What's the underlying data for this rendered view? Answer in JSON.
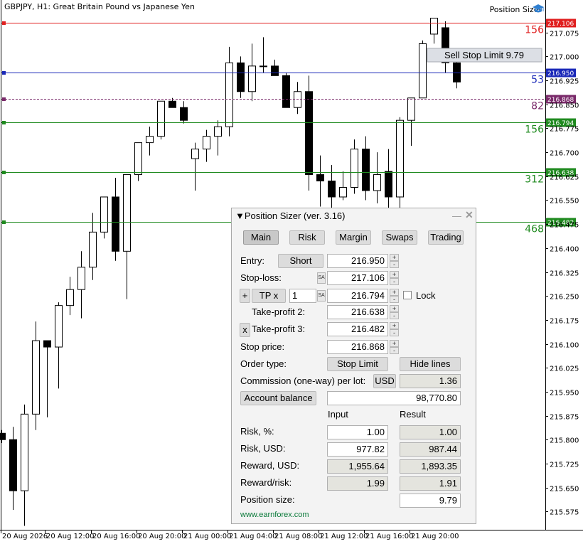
{
  "chart_data": {
    "type": "candlestick",
    "symbol_title": "GBPJPY, H1:  Great Britain Pound vs Japanese Yen",
    "price_range": [
      215.52,
      217.13
    ],
    "price_ticks": [
      "217.075",
      "217.000",
      "216.925",
      "216.850",
      "216.775",
      "216.700",
      "216.625",
      "216.550",
      "216.475",
      "216.400",
      "216.325",
      "216.250",
      "216.175",
      "216.100",
      "216.025",
      "215.950",
      "215.875",
      "215.800",
      "215.725",
      "215.650",
      "215.575"
    ],
    "time_labels": [
      "20 Aug 2026",
      "20 Aug 12:00",
      "20 Aug 16:00",
      "20 Aug 20:00",
      "21 Aug 00:00",
      "21 Aug 04:00",
      "21 Aug 08:00",
      "21 Aug 12:00",
      "21 Aug 16:00",
      "21 Aug 20:00"
    ],
    "candles": [
      {
        "o": 215.82,
        "h": 215.83,
        "l": 215.79,
        "c": 215.8
      },
      {
        "o": 215.8,
        "h": 215.84,
        "l": 215.58,
        "c": 215.64
      },
      {
        "o": 215.64,
        "h": 215.91,
        "l": 215.53,
        "c": 215.88
      },
      {
        "o": 215.88,
        "h": 216.17,
        "l": 215.83,
        "c": 216.11
      },
      {
        "o": 216.11,
        "h": 216.11,
        "l": 215.87,
        "c": 216.09
      },
      {
        "o": 216.09,
        "h": 216.23,
        "l": 215.96,
        "c": 216.22
      },
      {
        "o": 216.22,
        "h": 216.31,
        "l": 216.19,
        "c": 216.27
      },
      {
        "o": 216.27,
        "h": 216.39,
        "l": 216.18,
        "c": 216.34
      },
      {
        "o": 216.34,
        "h": 216.51,
        "l": 216.3,
        "c": 216.45
      },
      {
        "o": 216.45,
        "h": 216.56,
        "l": 216.43,
        "c": 216.56
      },
      {
        "o": 216.56,
        "h": 216.62,
        "l": 216.36,
        "c": 216.39
      },
      {
        "o": 216.39,
        "h": 216.63,
        "l": 216.24,
        "c": 216.63
      },
      {
        "o": 216.63,
        "h": 216.73,
        "l": 216.61,
        "c": 216.73
      },
      {
        "o": 216.73,
        "h": 216.78,
        "l": 216.69,
        "c": 216.75
      },
      {
        "o": 216.75,
        "h": 216.86,
        "l": 216.74,
        "c": 216.86
      },
      {
        "o": 216.86,
        "h": 216.87,
        "l": 216.84,
        "c": 216.84
      },
      {
        "o": 216.84,
        "h": 216.86,
        "l": 216.79,
        "c": 216.8
      },
      {
        "o": 216.68,
        "h": 216.73,
        "l": 216.58,
        "c": 216.71
      },
      {
        "o": 216.71,
        "h": 216.77,
        "l": 216.67,
        "c": 216.75
      },
      {
        "o": 216.75,
        "h": 216.8,
        "l": 216.69,
        "c": 216.78
      },
      {
        "o": 216.78,
        "h": 217.03,
        "l": 216.75,
        "c": 216.98
      },
      {
        "o": 216.98,
        "h": 217.0,
        "l": 216.87,
        "c": 216.89
      },
      {
        "o": 216.89,
        "h": 217.04,
        "l": 216.86,
        "c": 216.97
      },
      {
        "o": 216.97,
        "h": 217.06,
        "l": 216.95,
        "c": 216.97
      },
      {
        "o": 216.97,
        "h": 216.99,
        "l": 216.95,
        "c": 216.94
      },
      {
        "o": 216.94,
        "h": 216.95,
        "l": 216.84,
        "c": 216.84
      },
      {
        "o": 216.84,
        "h": 216.92,
        "l": 216.82,
        "c": 216.89
      },
      {
        "o": 216.89,
        "h": 216.94,
        "l": 216.58,
        "c": 216.63
      },
      {
        "o": 216.63,
        "h": 216.69,
        "l": 216.53,
        "c": 216.61
      },
      {
        "o": 216.61,
        "h": 216.66,
        "l": 216.48,
        "c": 216.56
      },
      {
        "o": 216.56,
        "h": 216.64,
        "l": 216.55,
        "c": 216.59
      },
      {
        "o": 216.59,
        "h": 216.74,
        "l": 216.57,
        "c": 216.71
      },
      {
        "o": 216.71,
        "h": 216.75,
        "l": 216.55,
        "c": 216.58
      },
      {
        "o": 216.58,
        "h": 216.7,
        "l": 216.54,
        "c": 216.63
      },
      {
        "o": 216.64,
        "h": 216.71,
        "l": 216.52,
        "c": 216.56
      },
      {
        "o": 216.56,
        "h": 216.81,
        "l": 216.52,
        "c": 216.8
      },
      {
        "o": 216.8,
        "h": 216.87,
        "l": 216.72,
        "c": 216.87
      },
      {
        "o": 216.87,
        "h": 217.05,
        "l": 216.87,
        "c": 217.04
      },
      {
        "o": 217.07,
        "h": 217.12,
        "l": 217.04,
        "c": 217.12
      },
      {
        "o": 217.09,
        "h": 217.11,
        "l": 216.95,
        "c": 216.98
      },
      {
        "o": 216.98,
        "h": 217.01,
        "l": 216.9,
        "c": 216.92
      }
    ],
    "lines": [
      {
        "price": 217.106,
        "label": "217.106",
        "points": "156",
        "color": "#e02020",
        "style": "solid",
        "text_color": "#e02020"
      },
      {
        "price": 216.95,
        "label": "216.950",
        "points": "53",
        "color": "#1a28b8",
        "style": "solid",
        "text_color": "#1a28b8"
      },
      {
        "price": 216.868,
        "label": "216.868",
        "points": "82",
        "color": "#7a2a6a",
        "style": "dashed",
        "text_color": "#7a2a6a"
      },
      {
        "price": 216.794,
        "label": "216.794",
        "points": "156",
        "color": "#1f8a1f",
        "style": "solid",
        "text_color": "#1f8a1f"
      },
      {
        "price": 216.638,
        "label": "216.638",
        "points": "312",
        "color": "#1f8a1f",
        "style": "solid",
        "text_color": "#1f8a1f"
      },
      {
        "price": 216.482,
        "label": "216.482",
        "points": "468",
        "color": "#1f8a1f",
        "style": "solid",
        "text_color": "#1f8a1f"
      }
    ],
    "order_label": "Sell Stop Limit 9.79"
  },
  "header": {
    "position_sizer_label": "Position Sizer",
    "icon": "graduation-cap-icon"
  },
  "panel": {
    "title": "Position Sizer (ver. 3.16)",
    "collapse_icon": "▼",
    "minimize_glyph": "—",
    "close_glyph": "✕",
    "tabs": [
      "Main",
      "Risk",
      "Margin",
      "Swaps",
      "Trading"
    ],
    "entry_label": "Entry:",
    "entry_button": "Short",
    "entry_value": "216.950",
    "sl_label": "Stop-loss:",
    "sl_value": "217.106",
    "sa_text": "SA",
    "plus_glyph": "+",
    "minus_glyph": "-",
    "tp_add": "+",
    "tp_button": "TP x",
    "tp_multiplier": "1",
    "tp1_value": "216.794",
    "lock_label": "Lock",
    "tp2_label": "Take-profit 2:",
    "tp2_value": "216.638",
    "tp3_remove": "x",
    "tp3_label": "Take-profit 3:",
    "tp3_value": "216.482",
    "stop_price_label": "Stop price:",
    "stop_price_value": "216.868",
    "order_type_label": "Order type:",
    "order_type_button": "Stop Limit",
    "hide_lines_button": "Hide lines",
    "commission_label": "Commission (one-way) per lot:",
    "commission_currency": "USD",
    "commission_value": "1.36",
    "account_balance_button": "Account balance",
    "account_balance_value": "98,770.80",
    "col_input": "Input",
    "col_result": "Result",
    "risk_pct_label": "Risk, %:",
    "risk_pct_input": "1.00",
    "risk_pct_result": "1.00",
    "risk_usd_label": "Risk, USD:",
    "risk_usd_input": "977.82",
    "risk_usd_result": "987.44",
    "reward_usd_label": "Reward, USD:",
    "reward_usd_input": "1,955.64",
    "reward_usd_result": "1,893.35",
    "rr_label": "Reward/risk:",
    "rr_input": "1.99",
    "rr_result": "1.91",
    "pos_size_label": "Position size:",
    "pos_size_result": "9.79",
    "website": "www.earnforex.com"
  }
}
